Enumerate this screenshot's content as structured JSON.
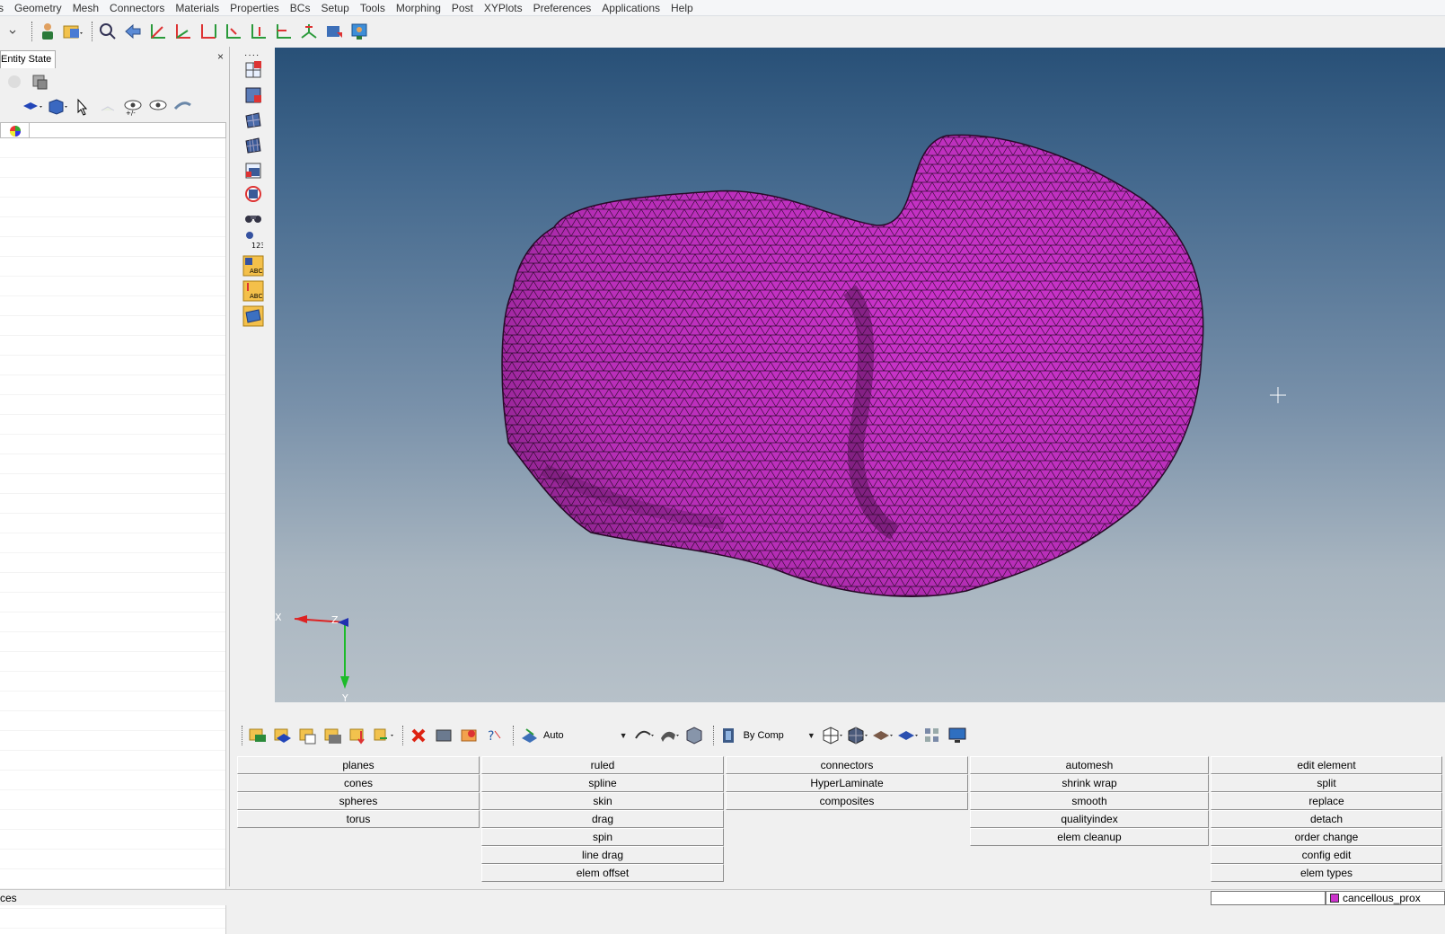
{
  "menu": [
    "s",
    "Geometry",
    "Mesh",
    "Connectors",
    "Materials",
    "Properties",
    "BCs",
    "Setup",
    "Tools",
    "Morphing",
    "Post",
    "XYPlots",
    "Preferences",
    "Applications",
    "Help"
  ],
  "left_panel": {
    "tab_label": "Entity State",
    "close_label": "×"
  },
  "viewport": {
    "axis": {
      "x_label": "X",
      "z_label": "Z",
      "y_label": "Y"
    },
    "mesh_color": "#cc33cc",
    "edge_color": "#3a0d3a",
    "background_top": "#285077",
    "background_bottom": "#b7c1c9"
  },
  "bottom_toolbar": {
    "auto_label": "Auto",
    "bycomp_label": "By Comp"
  },
  "panel": {
    "col1": [
      "planes",
      "cones",
      "spheres",
      "torus"
    ],
    "col2": [
      "ruled",
      "spline",
      "skin",
      "drag",
      "spin",
      "line drag",
      "elem offset"
    ],
    "col3": [
      "connectors",
      "HyperLaminate",
      "composites"
    ],
    "col4": [
      "automesh",
      "shrink wrap",
      "smooth",
      "qualityindex",
      "elem cleanup"
    ],
    "col5": [
      "edit element",
      "split",
      "replace",
      "detach",
      "order change",
      "config edit",
      "elem types"
    ]
  },
  "status": {
    "left_text": "ces",
    "component": "cancellous_prox",
    "component_color": "#cc33cc"
  }
}
